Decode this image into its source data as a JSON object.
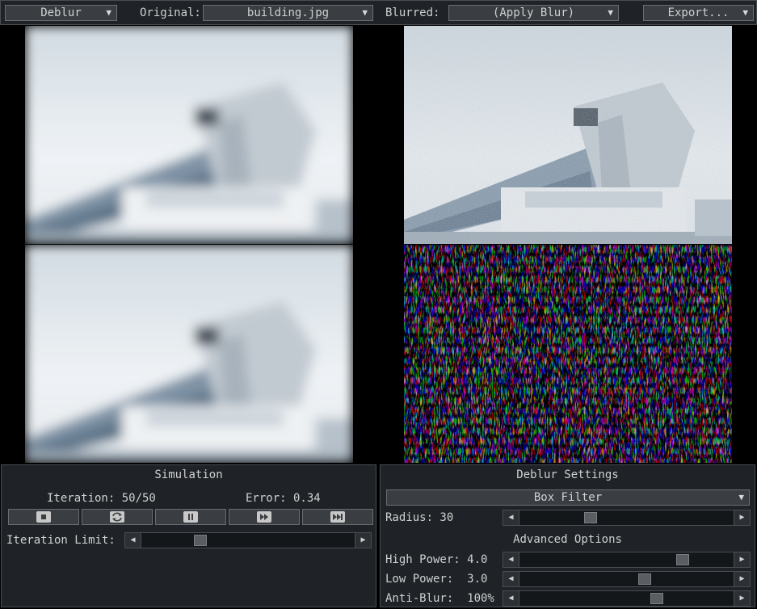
{
  "toolbar": {
    "mode": "Deblur",
    "original_label": "Original:",
    "original_value": "building.jpg",
    "blurred_label": "Blurred:",
    "blurred_value": "(Apply Blur)",
    "export_label": "Export..."
  },
  "simulation": {
    "title": "Simulation",
    "iteration_text": "Iteration: 50/50",
    "error_text": "Error: 0.34",
    "iteration_limit_label": "Iteration Limit:",
    "iteration_limit_level": 0.26,
    "buttons": [
      "stop-icon",
      "reset-icon",
      "pause-icon",
      "step-icon",
      "fast-forward-icon"
    ]
  },
  "deblur_settings": {
    "title": "Deblur Settings",
    "filter": "Box Filter",
    "radius_label": "Radius: 30",
    "radius_level": 0.32,
    "advanced_title": "Advanced Options",
    "high_power_label": "High Power: 4.0",
    "high_power_level": 0.78,
    "low_power_label": "Low Power:  3.0",
    "low_power_level": 0.59,
    "anti_blur_label": "Anti-Blur:  100%",
    "anti_blur_level": 0.65
  },
  "colors": {
    "panel_bg": "#1f2327",
    "border": "#4a4e52",
    "control_bg": "#3a3e42",
    "text": "#d0d0d0"
  }
}
